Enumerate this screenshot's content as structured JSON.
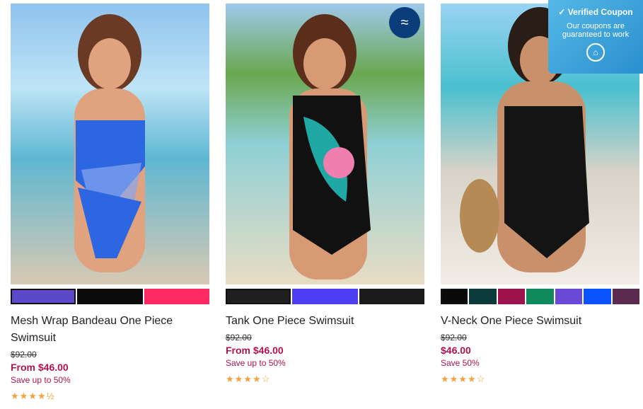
{
  "products": [
    {
      "title": "Mesh Wrap Bandeau One Piece Swimsuit",
      "old_price": "$92.00",
      "new_price": "From $46.00",
      "save": "Save up to 50%",
      "stars": "★★★★½",
      "swatches": [
        "#5b49c9",
        "#0b0b0b",
        "#ff2a63"
      ],
      "selected": 0
    },
    {
      "title": "Tank One Piece Swimsuit",
      "old_price": "$92.00",
      "new_price": "From $46.00",
      "save": "Save up to 50%",
      "stars": "★★★★☆",
      "swatches": [
        "#1f1f1f",
        "#4d3ef1",
        "#1b1b1b"
      ],
      "selected": 0
    },
    {
      "title": "V-Neck One Piece Swimsuit",
      "old_price": "$92.00",
      "new_price": "$46.00",
      "save": "Save 50%",
      "stars": "★★★★☆",
      "swatches": [
        "#0a0a0a",
        "#0b3b3a",
        "#9b124c",
        "#0f8a5f",
        "#6a48d6",
        "#0a53ff",
        "#5b2a4f"
      ],
      "selected": 0
    }
  ],
  "coupon": {
    "title": "Verified Coupon",
    "line1": "Our coupons are",
    "line2": "guaranteed to work"
  },
  "colors": {
    "accent": "#b0124f",
    "coupon_bg": "#2a8fcf"
  }
}
